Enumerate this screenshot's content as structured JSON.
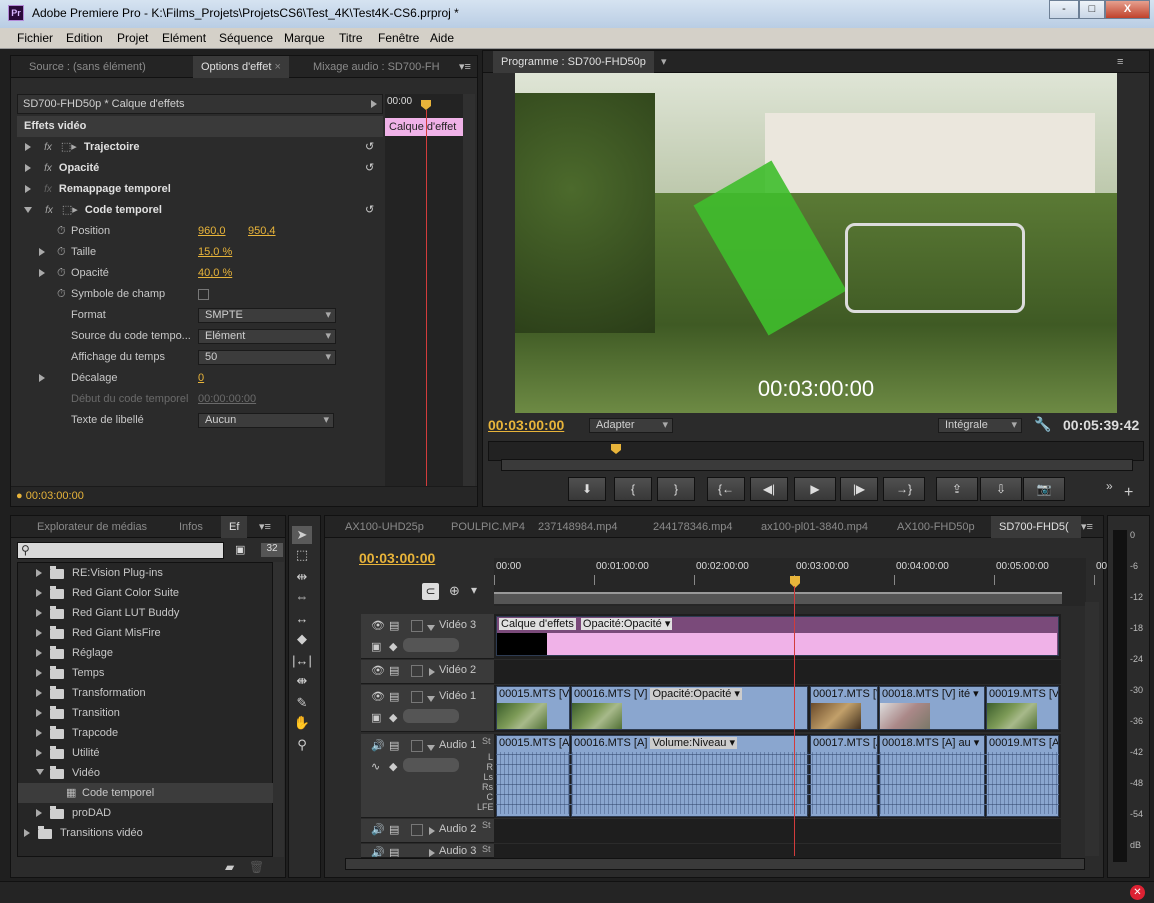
{
  "app": {
    "title": "Adobe Premiere Pro - K:\\Films_Projets\\ProjetsCS6\\Test_4K\\Test4K-CS6.prproj *",
    "icon_label": "Pr",
    "window_buttons": [
      "-",
      "□",
      "X"
    ]
  },
  "menu": [
    "Fichier",
    "Edition",
    "Projet",
    "Elément",
    "Séquence",
    "Marque",
    "Titre",
    "Fenêtre",
    "Aide"
  ],
  "effect_panel": {
    "tabs": [
      "Source : (sans élément)",
      "Options d'effet",
      "Mixage audio : SD700-FH"
    ],
    "clip_header": "SD700-FHD50p * Calque d'effets",
    "ruler_time": "00:00",
    "clip_bar_label": "Calque d'effet",
    "section": "Effets vidéo",
    "effects": [
      {
        "name": "Trajectoire",
        "fx": "fx"
      },
      {
        "name": "Opacité",
        "fx": "fx"
      },
      {
        "name": "Remappage temporel",
        "fx": "fx"
      },
      {
        "name": "Code temporel",
        "fx": "fx"
      }
    ],
    "params": {
      "position_label": "Position",
      "position_x": "960,0",
      "position_y": "950,4",
      "taille_label": "Taille",
      "taille_value": "15,0 %",
      "opacite_label": "Opacité",
      "opacite_value": "40,0 %",
      "symbole_label": "Symbole de champ",
      "format_label": "Format",
      "format_value": "SMPTE",
      "source_label": "Source du code tempo...",
      "source_value": "Elément",
      "affichage_label": "Affichage du temps",
      "affichage_value": "50",
      "decalage_label": "Décalage",
      "decalage_value": "0",
      "debut_label": "Début du code temporel",
      "debut_value": "00:00:00:00",
      "texte_label": "Texte de libellé",
      "texte_value": "Aucun"
    },
    "current_time": "00:03:00:00"
  },
  "program_monitor": {
    "tab": "Programme : SD700-FHD50p",
    "overlay_timecode": "00:03:00:00",
    "current_time": "00:03:00:00",
    "fit_value": "Adapter",
    "quality_value": "Intégrale",
    "duration": "00:05:39:42",
    "transport": [
      "⬇",
      "{",
      "}",
      "{←",
      "◀|",
      "▶",
      "|▶",
      "→}",
      "⇪",
      "⇩",
      "📷"
    ]
  },
  "media_browser": {
    "tabs": [
      "Explorateur de médias",
      "Infos",
      "Ef"
    ],
    "icon_count": "32",
    "items": [
      {
        "label": "RE:Vision Plug-ins",
        "indent": 1,
        "open": false
      },
      {
        "label": "Red Giant Color Suite",
        "indent": 1,
        "open": false
      },
      {
        "label": "Red Giant LUT Buddy",
        "indent": 1,
        "open": false
      },
      {
        "label": "Red Giant MisFire",
        "indent": 1,
        "open": false
      },
      {
        "label": "Réglage",
        "indent": 1,
        "open": false
      },
      {
        "label": "Temps",
        "indent": 1,
        "open": false
      },
      {
        "label": "Transformation",
        "indent": 1,
        "open": false
      },
      {
        "label": "Transition",
        "indent": 1,
        "open": false
      },
      {
        "label": "Trapcode",
        "indent": 1,
        "open": false
      },
      {
        "label": "Utilité",
        "indent": 1,
        "open": false
      },
      {
        "label": "Vidéo",
        "indent": 1,
        "open": true
      },
      {
        "label": "Code temporel",
        "indent": 2,
        "open": false
      },
      {
        "label": "proDAD",
        "indent": 1,
        "open": false
      },
      {
        "label": "Transitions vidéo",
        "indent": 0,
        "open": false
      }
    ]
  },
  "timeline": {
    "tabs": [
      "AX100-UHD25p",
      "POULPIC.MP4",
      "237148984.mp4",
      "244178346.mp4",
      "ax100-pl01-3840.mp4",
      "AX100-FHD50p",
      "SD700-FHD5("
    ],
    "current_time": "00:03:00:00",
    "ruler": [
      "00:00",
      "00:01:00:00",
      "00:02:00:00",
      "00:03:00:00",
      "00:04:00:00",
      "00:05:00:00",
      "00:0"
    ],
    "tracks": {
      "v3": "Vidéo 3",
      "v2": "Vidéo 2",
      "v1": "Vidéo 1",
      "a1": "Audio 1",
      "a2": "Audio 2",
      "a3": "Audio 3"
    },
    "v3_clip": "Calque d'effets",
    "v3_fx": "Opacité:Opacité ▾",
    "v1_clips": [
      "00015.MTS [V]",
      "00016.MTS [V]",
      "Opacité:Opacité ▾",
      "00017.MTS [V",
      "00018.MTS [V]",
      "ité ▾",
      "00019.MTS [V]"
    ],
    "a1_clips": [
      "00015.MTS [A]",
      "00016.MTS [A]",
      "Volume:Niveau ▾",
      "00017.MTS [A",
      "00018.MTS [A]",
      "au ▾",
      "00019.MTS [A"
    ],
    "channels": [
      "L",
      "R",
      "Ls",
      "Rs",
      "C",
      "LFE"
    ],
    "st_label": "St"
  },
  "audio_meter": {
    "scale": [
      "0",
      "-6",
      "-12",
      "-18",
      "-24",
      "-30",
      "-36",
      "-42",
      "-48",
      "-54",
      "dB"
    ]
  }
}
